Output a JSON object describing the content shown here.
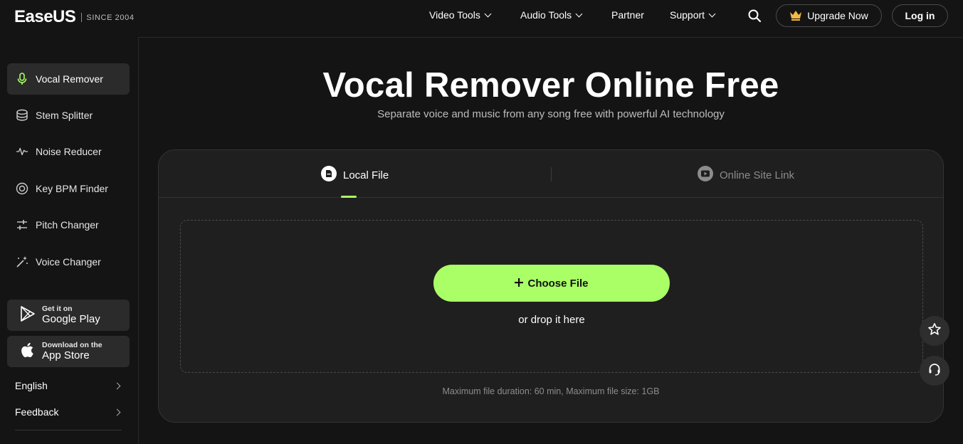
{
  "header": {
    "logo_text": "EaseUS",
    "since": "SINCE 2004",
    "nav": [
      {
        "label": "Video Tools"
      },
      {
        "label": "Audio Tools"
      },
      {
        "label": "Partner"
      },
      {
        "label": "Support"
      }
    ],
    "upgrade_label": "Upgrade Now",
    "login_label": "Log in"
  },
  "sidebar": {
    "items": [
      {
        "label": "Vocal Remover",
        "icon": "microphone-icon",
        "active": true
      },
      {
        "label": "Stem Splitter",
        "icon": "stem-icon"
      },
      {
        "label": "Noise Reducer",
        "icon": "waveform-icon"
      },
      {
        "label": "Key BPM Finder",
        "icon": "target-icon"
      },
      {
        "label": "Pitch Changer",
        "icon": "sliders-icon"
      },
      {
        "label": "Voice Changer",
        "icon": "magic-wand-icon"
      }
    ],
    "google_play": {
      "small": "Get it on",
      "big": "Google Play"
    },
    "app_store": {
      "small": "Download on the",
      "big": "App Store"
    },
    "language": "English",
    "feedback": "Feedback"
  },
  "main": {
    "title": "Vocal Remover Online Free",
    "subtitle": "Separate voice and music from any song free with powerful AI technology",
    "tabs": [
      {
        "label": "Local File",
        "active": true
      },
      {
        "label": "Online Site Link",
        "active": false
      }
    ],
    "choose_label": "Choose File",
    "drop_text": "or drop it here",
    "limit_text": "Maximum file duration: 60 min, Maximum file size: 1GB"
  },
  "colors": {
    "accent": "#aaff66",
    "background": "#141414",
    "card": "#1f1f1f"
  }
}
